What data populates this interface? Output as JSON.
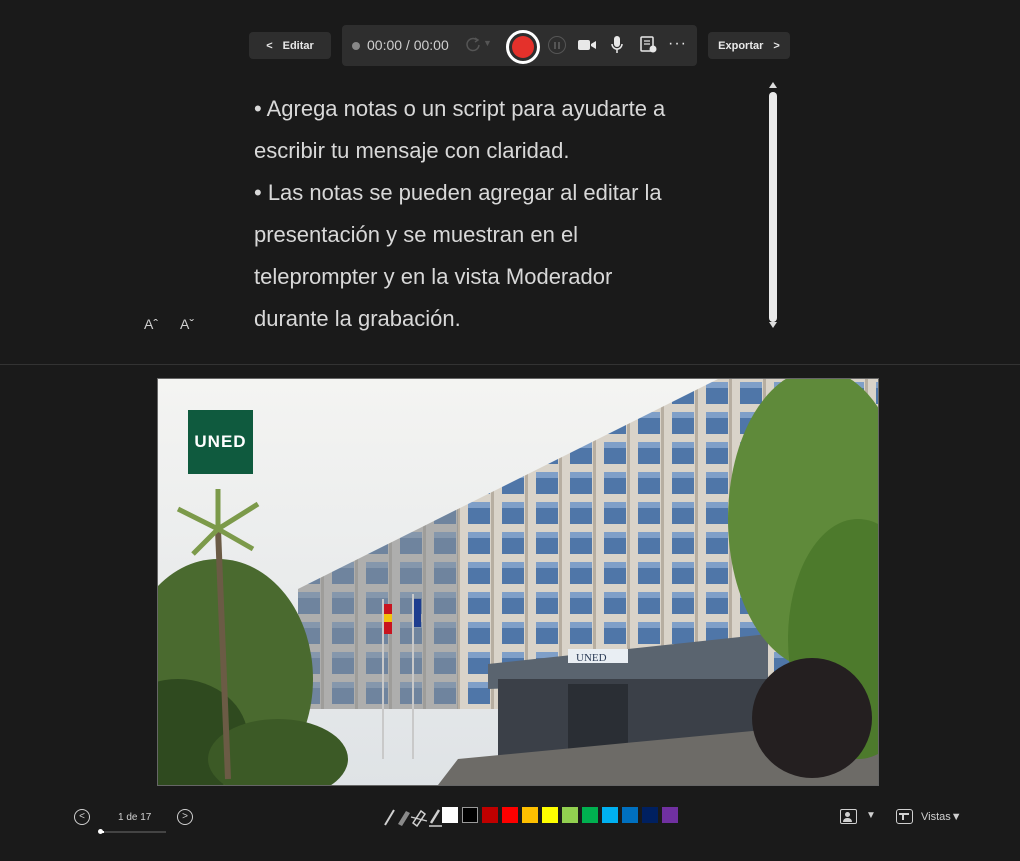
{
  "toolbar": {
    "edit_label": "Editar",
    "timer": "00:00 / 00:00",
    "export_label": "Exportar",
    "more_glyph": "···",
    "record_color": "#e4312b"
  },
  "teleprompter": {
    "lines": [
      "• Agrega notas o un script para ayudarte a",
      "escribir tu mensaje con claridad.",
      "• Las notas se pueden agregar al editar la",
      "presentación y se muestran en el",
      "teleprompter y en la vista Moderador",
      "durante la grabación."
    ],
    "increase_font_label": "Aˆ",
    "decrease_font_label": "Aˇ"
  },
  "slide": {
    "logo_text": "UNED",
    "building_sign": "UNED",
    "brand_color": "#0f5a3e"
  },
  "navigation": {
    "page_label": "1 de 17",
    "current_page": 1,
    "total_pages": 17,
    "progress_fraction": 0.0588
  },
  "ink": {
    "tools": [
      "pen-icon",
      "highlighter-icon",
      "eraser-icon",
      "marker-icon"
    ],
    "colors": [
      "#ffffff",
      "#000000",
      "#c00000",
      "#ff0000",
      "#ffc000",
      "#ffff00",
      "#92d050",
      "#00b050",
      "#00b0f0",
      "#0070c0",
      "#002060",
      "#7030a0"
    ]
  },
  "views": {
    "label": "Vistas",
    "caret": "▼",
    "person_caret": "▼"
  }
}
